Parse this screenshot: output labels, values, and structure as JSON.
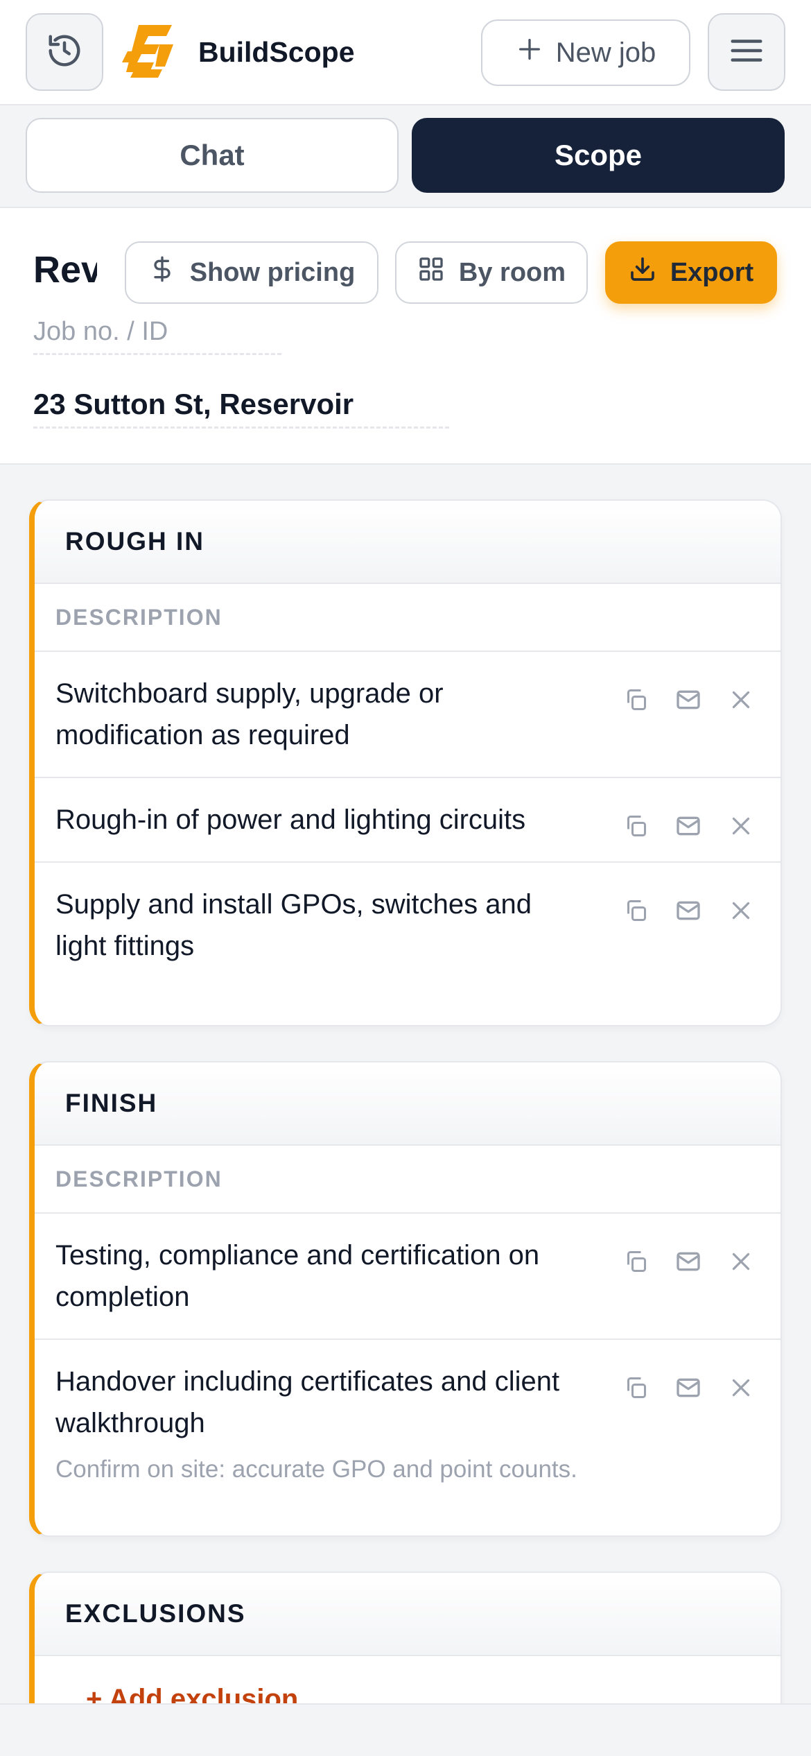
{
  "header": {
    "brand": "BuildScope",
    "new_job_label": "New job",
    "history_icon": "history-icon",
    "menu_icon": "hamburger-menu-icon",
    "accent_color": "#f59e0b"
  },
  "tabs": [
    {
      "label": "Chat",
      "active": false
    },
    {
      "label": "Scope",
      "active": true
    }
  ],
  "job": {
    "title": "Rev",
    "job_id_placeholder": "Job no. / ID",
    "address": "23 Sutton St, Reservoir",
    "actions": {
      "show_pricing": "Show pricing",
      "by_room": "By room",
      "export": "Export"
    }
  },
  "sections": {
    "rough_in": {
      "title": "ROUGH IN",
      "column": "DESCRIPTION",
      "items": [
        {
          "text": "Switchboard supply, upgrade or modification as required"
        },
        {
          "text": "Rough-in of power and lighting circuits"
        },
        {
          "text": "Supply and install GPOs, switches and light fittings"
        }
      ]
    },
    "finish": {
      "title": "FINISH",
      "column": "DESCRIPTION",
      "items": [
        {
          "text": "Testing, compliance and certification on completion",
          "note": ""
        },
        {
          "text": "Handover including certificates and client walkthrough",
          "note": "Confirm on site: accurate GPO and point counts."
        }
      ]
    },
    "exclusions": {
      "title": "EXCLUSIONS",
      "add_label": "+ Add exclusion"
    }
  }
}
